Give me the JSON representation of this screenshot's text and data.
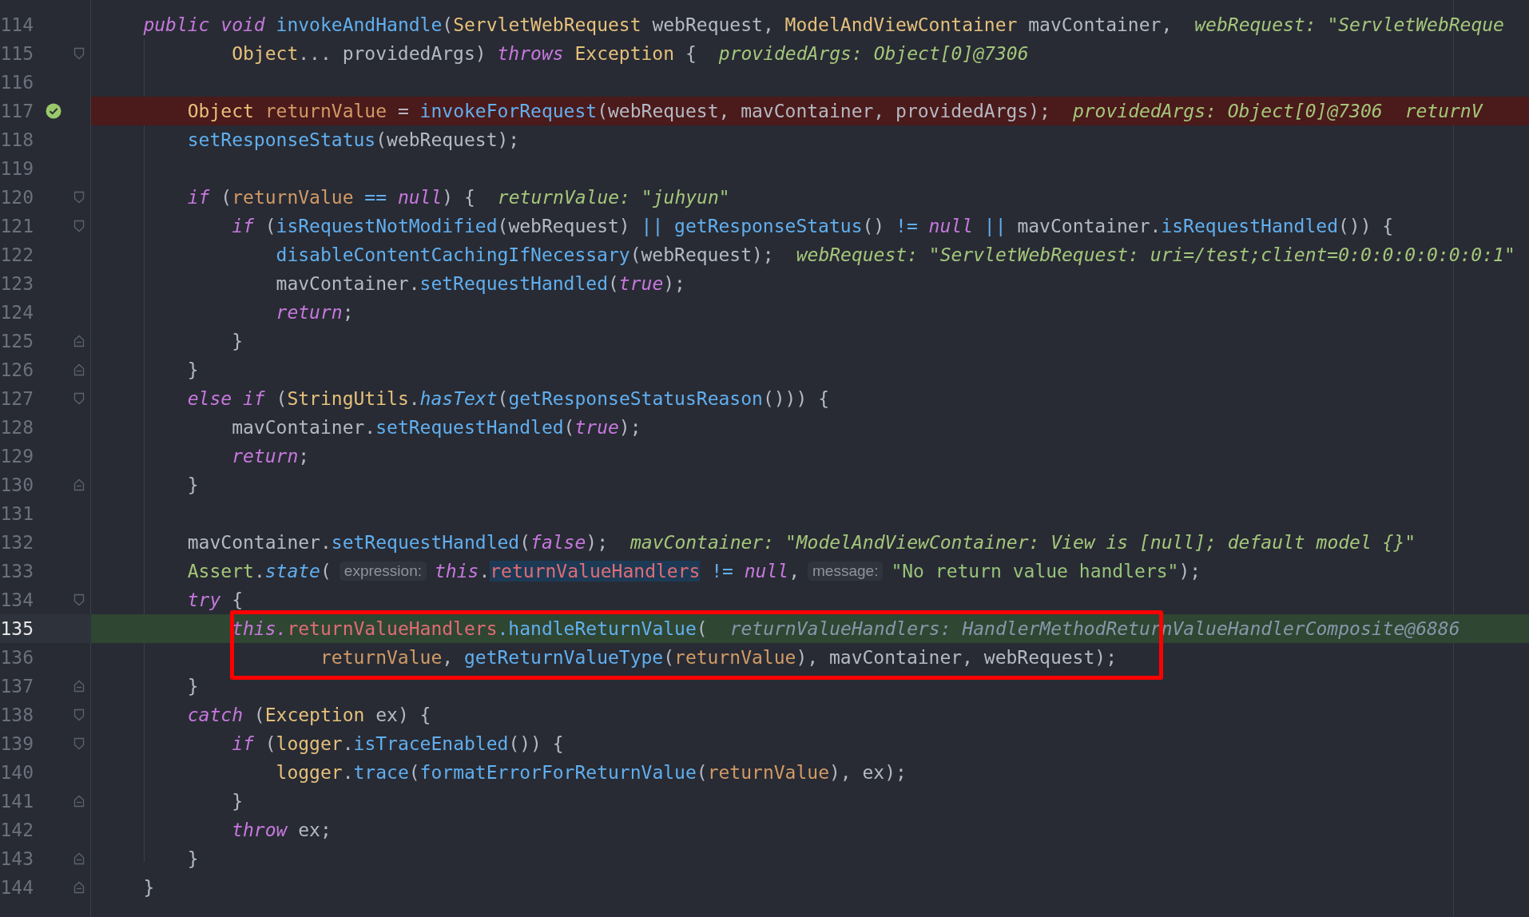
{
  "editor": {
    "lines": [
      {
        "number": "114",
        "segments": [
          {
            "kind": "code",
            "tokens": [
              {
                "text": "    public",
                "kind": "kw"
              },
              {
                "text": " void",
                "kind": "kw"
              },
              {
                "text": " invokeAndHandle",
                "kind": "fn"
              },
              {
                "text": "(",
                "kind": "plain"
              },
              {
                "text": "ServletWebRequest",
                "kind": "type"
              },
              {
                "text": " webRequest, ",
                "kind": "plain"
              },
              {
                "text": "ModelAndViewContainer",
                "kind": "type"
              },
              {
                "text": " mavContainer,",
                "kind": "plain"
              }
            ]
          },
          {
            "kind": "hint",
            "text": "webRequest: \"ServletWebReque"
          }
        ]
      },
      {
        "number": "115",
        "fold_start": true,
        "segments": [
          {
            "kind": "code",
            "tokens": [
              {
                "text": "            Object",
                "kind": "type"
              },
              {
                "text": "... providedArgs) ",
                "kind": "plain"
              },
              {
                "text": "throws",
                "kind": "kw"
              },
              {
                "text": " Exception",
                "kind": "type"
              },
              {
                "text": " {",
                "kind": "plain"
              }
            ]
          },
          {
            "kind": "hint",
            "text": "providedArgs: Object[0]@7306"
          }
        ]
      },
      {
        "number": "116"
      },
      {
        "number": "117",
        "breakpoint": true,
        "verified": true,
        "segments": [
          {
            "kind": "code",
            "tokens": [
              {
                "text": "        Object",
                "kind": "type"
              },
              {
                "text": " returnValue",
                "kind": "local"
              },
              {
                "text": " = ",
                "kind": "plain"
              },
              {
                "text": "invokeForRequest",
                "kind": "fn"
              },
              {
                "text": "(webRequest, mavContainer, providedArgs);",
                "kind": "plain"
              }
            ]
          },
          {
            "kind": "hint",
            "text": "providedArgs: Object[0]@7306"
          },
          {
            "kind": "hint",
            "text": "returnV"
          }
        ]
      },
      {
        "number": "118",
        "segments": [
          {
            "kind": "code",
            "tokens": [
              {
                "text": "        setResponseStatus",
                "kind": "fn"
              },
              {
                "text": "(webRequest);",
                "kind": "plain"
              }
            ]
          }
        ]
      },
      {
        "number": "119"
      },
      {
        "number": "120",
        "fold_start": true,
        "segments": [
          {
            "kind": "code",
            "tokens": [
              {
                "text": "        if",
                "kind": "kw"
              },
              {
                "text": " (",
                "kind": "plain"
              },
              {
                "text": "returnValue",
                "kind": "local"
              },
              {
                "text": " ==",
                "kind": "op"
              },
              {
                "text": " null",
                "kind": "kw"
              },
              {
                "text": ") {",
                "kind": "plain"
              }
            ]
          },
          {
            "kind": "hint",
            "text": "returnValue: \"juhyun\""
          }
        ]
      },
      {
        "number": "121",
        "fold_start": true,
        "segments": [
          {
            "kind": "code",
            "tokens": [
              {
                "text": "            if",
                "kind": "kw"
              },
              {
                "text": " (",
                "kind": "plain"
              },
              {
                "text": "isRequestNotModified",
                "kind": "fn"
              },
              {
                "text": "(webRequest) ",
                "kind": "plain"
              },
              {
                "text": "||",
                "kind": "op"
              },
              {
                "text": " getResponseStatus",
                "kind": "fn"
              },
              {
                "text": "() ",
                "kind": "plain"
              },
              {
                "text": "!=",
                "kind": "op"
              },
              {
                "text": " null",
                "kind": "kw"
              },
              {
                "text": " ||",
                "kind": "op"
              },
              {
                "text": " mavContainer.",
                "kind": "plain"
              },
              {
                "text": "isRequestHandled",
                "kind": "fn"
              },
              {
                "text": "()) {",
                "kind": "plain"
              }
            ]
          }
        ]
      },
      {
        "number": "122",
        "segments": [
          {
            "kind": "code",
            "tokens": [
              {
                "text": "                disableContentCachingIfNecessary",
                "kind": "fn"
              },
              {
                "text": "(webRequest);",
                "kind": "plain"
              }
            ]
          },
          {
            "kind": "hint",
            "text": "webRequest: \"ServletWebRequest: uri=/test;client=0:0:0:0:0:0:0:1\""
          }
        ]
      },
      {
        "number": "123",
        "segments": [
          {
            "kind": "code",
            "tokens": [
              {
                "text": "                mavContainer.",
                "kind": "plain"
              },
              {
                "text": "setRequestHandled",
                "kind": "fn"
              },
              {
                "text": "(",
                "kind": "plain"
              },
              {
                "text": "true",
                "kind": "kw"
              },
              {
                "text": ");",
                "kind": "plain"
              }
            ]
          }
        ]
      },
      {
        "number": "124",
        "segments": [
          {
            "kind": "code",
            "tokens": [
              {
                "text": "                return",
                "kind": "kw"
              },
              {
                "text": ";",
                "kind": "plain"
              }
            ]
          }
        ]
      },
      {
        "number": "125",
        "fold_end": true,
        "segments": [
          {
            "kind": "code",
            "tokens": [
              {
                "text": "            }",
                "kind": "plain"
              }
            ]
          }
        ]
      },
      {
        "number": "126",
        "fold_end": true,
        "segments": [
          {
            "kind": "code",
            "tokens": [
              {
                "text": "        }",
                "kind": "plain"
              }
            ]
          }
        ]
      },
      {
        "number": "127",
        "fold_start": true,
        "segments": [
          {
            "kind": "code",
            "tokens": [
              {
                "text": "        else if",
                "kind": "kw"
              },
              {
                "text": " (",
                "kind": "plain"
              },
              {
                "text": "StringUtils",
                "kind": "type"
              },
              {
                "text": ".",
                "kind": "plain"
              },
              {
                "text": "hasText",
                "kind": "fni"
              },
              {
                "text": "(",
                "kind": "plain"
              },
              {
                "text": "getResponseStatusReason",
                "kind": "fn"
              },
              {
                "text": "())) {",
                "kind": "plain"
              }
            ]
          }
        ]
      },
      {
        "number": "128",
        "segments": [
          {
            "kind": "code",
            "tokens": [
              {
                "text": "            mavContainer.",
                "kind": "plain"
              },
              {
                "text": "setRequestHandled",
                "kind": "fn"
              },
              {
                "text": "(",
                "kind": "plain"
              },
              {
                "text": "true",
                "kind": "kw"
              },
              {
                "text": ");",
                "kind": "plain"
              }
            ]
          }
        ]
      },
      {
        "number": "129",
        "segments": [
          {
            "kind": "code",
            "tokens": [
              {
                "text": "            return",
                "kind": "kw"
              },
              {
                "text": ";",
                "kind": "plain"
              }
            ]
          }
        ]
      },
      {
        "number": "130",
        "fold_end": true,
        "segments": [
          {
            "kind": "code",
            "tokens": [
              {
                "text": "        }",
                "kind": "plain"
              }
            ]
          }
        ]
      },
      {
        "number": "131"
      },
      {
        "number": "132",
        "segments": [
          {
            "kind": "code",
            "tokens": [
              {
                "text": "        mavContainer.",
                "kind": "plain"
              },
              {
                "text": "setRequestHandled",
                "kind": "fn"
              },
              {
                "text": "(",
                "kind": "plain"
              },
              {
                "text": "false",
                "kind": "kw"
              },
              {
                "text": ");",
                "kind": "plain"
              }
            ]
          },
          {
            "kind": "hint",
            "text": "mavContainer: \"ModelAndViewContainer: View is [null]; default model {}\""
          }
        ]
      },
      {
        "number": "133",
        "segments": [
          {
            "kind": "code",
            "tokens": [
              {
                "text": "        Assert",
                "kind": "cls"
              },
              {
                "text": ".",
                "kind": "plain"
              },
              {
                "text": "state",
                "kind": "fni"
              },
              {
                "text": "(",
                "kind": "plain"
              }
            ]
          },
          {
            "kind": "param",
            "text": "expression:"
          },
          {
            "kind": "code",
            "tokens": [
              {
                "text": "this",
                "kind": "kw"
              },
              {
                "text": ".",
                "kind": "plain"
              },
              {
                "text": "returnValueHandlers",
                "kind": "sel"
              },
              {
                "text": " !=",
                "kind": "op"
              },
              {
                "text": " null",
                "kind": "kw"
              },
              {
                "text": ",",
                "kind": "plain"
              }
            ]
          },
          {
            "kind": "param",
            "text": "message:"
          },
          {
            "kind": "code",
            "tokens": [
              {
                "text": "\"No return value handlers\"",
                "kind": "str"
              },
              {
                "text": ");",
                "kind": "plain"
              }
            ]
          }
        ]
      },
      {
        "number": "134",
        "fold_start": true,
        "segments": [
          {
            "kind": "code",
            "tokens": [
              {
                "text": "        try",
                "kind": "kw"
              },
              {
                "text": " {",
                "kind": "plain"
              }
            ]
          }
        ]
      },
      {
        "number": "135",
        "execution_point": true,
        "segments": [
          {
            "kind": "code",
            "tokens": [
              {
                "text": "            this.",
                "kind": "kw"
              },
              {
                "text": "returnValueHandlers",
                "kind": "field"
              },
              {
                "text": ".handleReturnValue",
                "kind": "fn"
              },
              {
                "text": "(",
                "kind": "plain"
              }
            ]
          },
          {
            "kind": "hint-muted",
            "text": "returnValueHandlers: HandlerMethodReturnValueHandlerComposite@6886"
          }
        ]
      },
      {
        "number": "136",
        "segments": [
          {
            "kind": "code",
            "tokens": [
              {
                "text": "                    returnValue",
                "kind": "local"
              },
              {
                "text": ", ",
                "kind": "plain"
              },
              {
                "text": "getReturnValueType",
                "kind": "fn"
              },
              {
                "text": "(",
                "kind": "plain"
              },
              {
                "text": "returnValue",
                "kind": "local"
              },
              {
                "text": "), mavContainer, webRequest);",
                "kind": "plain"
              }
            ]
          }
        ]
      },
      {
        "number": "137",
        "fold_end": true,
        "segments": [
          {
            "kind": "code",
            "tokens": [
              {
                "text": "        }",
                "kind": "plain"
              }
            ]
          }
        ]
      },
      {
        "number": "138",
        "fold_start": true,
        "segments": [
          {
            "kind": "code",
            "tokens": [
              {
                "text": "        catch",
                "kind": "kw"
              },
              {
                "text": " (",
                "kind": "plain"
              },
              {
                "text": "Exception",
                "kind": "type"
              },
              {
                "text": " ex) {",
                "kind": "plain"
              }
            ]
          }
        ]
      },
      {
        "number": "139",
        "fold_start": true,
        "segments": [
          {
            "kind": "code",
            "tokens": [
              {
                "text": "            if",
                "kind": "kw"
              },
              {
                "text": " (",
                "kind": "plain"
              },
              {
                "text": "logger",
                "kind": "type"
              },
              {
                "text": ".",
                "kind": "plain"
              },
              {
                "text": "isTraceEnabled",
                "kind": "fn"
              },
              {
                "text": "()) {",
                "kind": "plain"
              }
            ]
          }
        ]
      },
      {
        "number": "140",
        "segments": [
          {
            "kind": "code",
            "tokens": [
              {
                "text": "                logger",
                "kind": "type"
              },
              {
                "text": ".",
                "kind": "plain"
              },
              {
                "text": "trace",
                "kind": "fn"
              },
              {
                "text": "(",
                "kind": "plain"
              },
              {
                "text": "formatErrorForReturnValue",
                "kind": "fn"
              },
              {
                "text": "(",
                "kind": "plain"
              },
              {
                "text": "returnValue",
                "kind": "local"
              },
              {
                "text": "), ex);",
                "kind": "plain"
              }
            ]
          }
        ]
      },
      {
        "number": "141",
        "fold_end": true,
        "segments": [
          {
            "kind": "code",
            "tokens": [
              {
                "text": "            }",
                "kind": "plain"
              }
            ]
          }
        ]
      },
      {
        "number": "142",
        "segments": [
          {
            "kind": "code",
            "tokens": [
              {
                "text": "            throw",
                "kind": "kw"
              },
              {
                "text": " ex;",
                "kind": "plain"
              }
            ]
          }
        ]
      },
      {
        "number": "143",
        "fold_end": true,
        "segments": [
          {
            "kind": "code",
            "tokens": [
              {
                "text": "        }",
                "kind": "plain"
              }
            ]
          }
        ]
      },
      {
        "number": "144",
        "fold_end": true,
        "segments": [
          {
            "kind": "code",
            "tokens": [
              {
                "text": "    }",
                "kind": "plain"
              }
            ]
          }
        ]
      }
    ]
  }
}
